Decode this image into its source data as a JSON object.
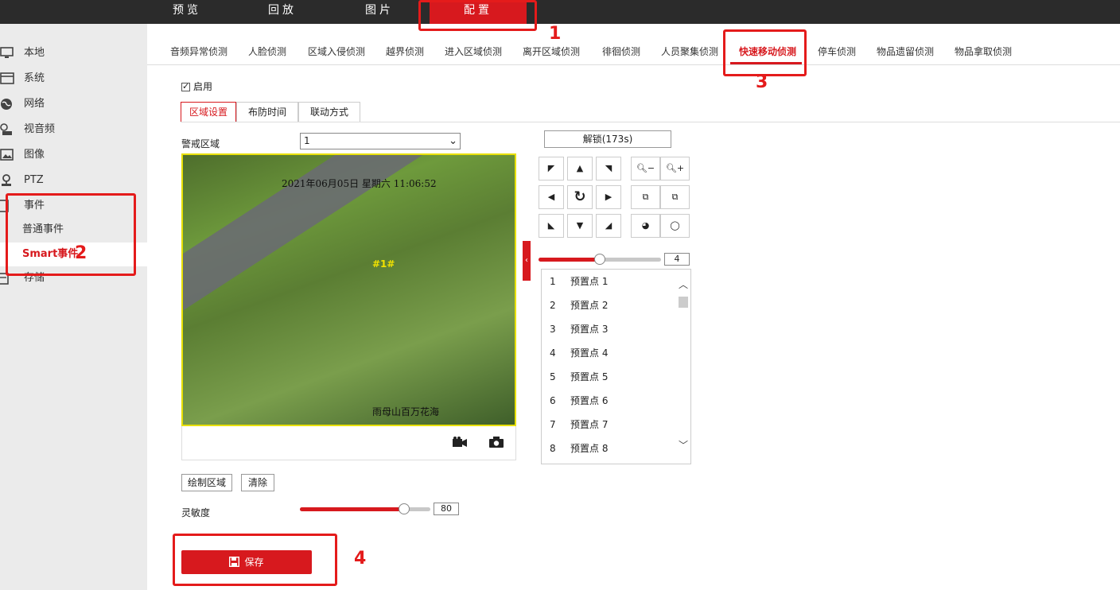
{
  "topnav": [
    "预览",
    "回放",
    "图片",
    "配置"
  ],
  "sidebar": {
    "items": [
      {
        "label": "本地",
        "icon": "monitor-icon"
      },
      {
        "label": "系统",
        "icon": "system-icon"
      },
      {
        "label": "网络",
        "icon": "globe-icon"
      },
      {
        "label": "视音频",
        "icon": "audio-video-icon"
      },
      {
        "label": "图像",
        "icon": "image-icon"
      },
      {
        "label": "PTZ",
        "icon": "ptz-icon"
      },
      {
        "label": "事件",
        "icon": "event-icon"
      },
      {
        "label": "存储",
        "icon": "storage-icon"
      }
    ],
    "sub_items": [
      "普通事件",
      "Smart事件"
    ]
  },
  "subtabs": [
    "音频异常侦测",
    "人脸侦测",
    "区域入侵侦测",
    "越界侦测",
    "进入区域侦测",
    "离开区域侦测",
    "徘徊侦测",
    "人员聚集侦测",
    "快速移动侦测",
    "停车侦测",
    "物品遗留侦测",
    "物品拿取侦测"
  ],
  "annotations": [
    "1",
    "2",
    "3",
    "4"
  ],
  "enable_label": "启用",
  "enable_checked": true,
  "inner_tabs": [
    "区域设置",
    "布防时间",
    "联动方式"
  ],
  "zone": {
    "label": "警戒区域",
    "value": "1"
  },
  "video": {
    "timestamp": "2021年06月05日  星期六  11:06:52",
    "zone_tag": "#1#",
    "location": "雨母山百万花海"
  },
  "unlock_label": "解锁(173s)",
  "ptz_speed": {
    "value": "4",
    "fraction": 0.5
  },
  "presets": [
    {
      "no": "1",
      "name": "预置点 1"
    },
    {
      "no": "2",
      "name": "预置点 2"
    },
    {
      "no": "3",
      "name": "预置点 3"
    },
    {
      "no": "4",
      "name": "预置点 4"
    },
    {
      "no": "5",
      "name": "预置点 5"
    },
    {
      "no": "6",
      "name": "预置点 6"
    },
    {
      "no": "7",
      "name": "预置点 7"
    },
    {
      "no": "8",
      "name": "预置点 8"
    }
  ],
  "buttons": {
    "draw": "绘制区域",
    "clear": "清除",
    "save": "保存"
  },
  "sensitivity": {
    "label": "灵敏度",
    "value": "80",
    "fraction": 0.8
  },
  "colors": {
    "accent": "#d7191e",
    "topbar": "#2b2b2b",
    "annotation": "#e41b1b"
  }
}
